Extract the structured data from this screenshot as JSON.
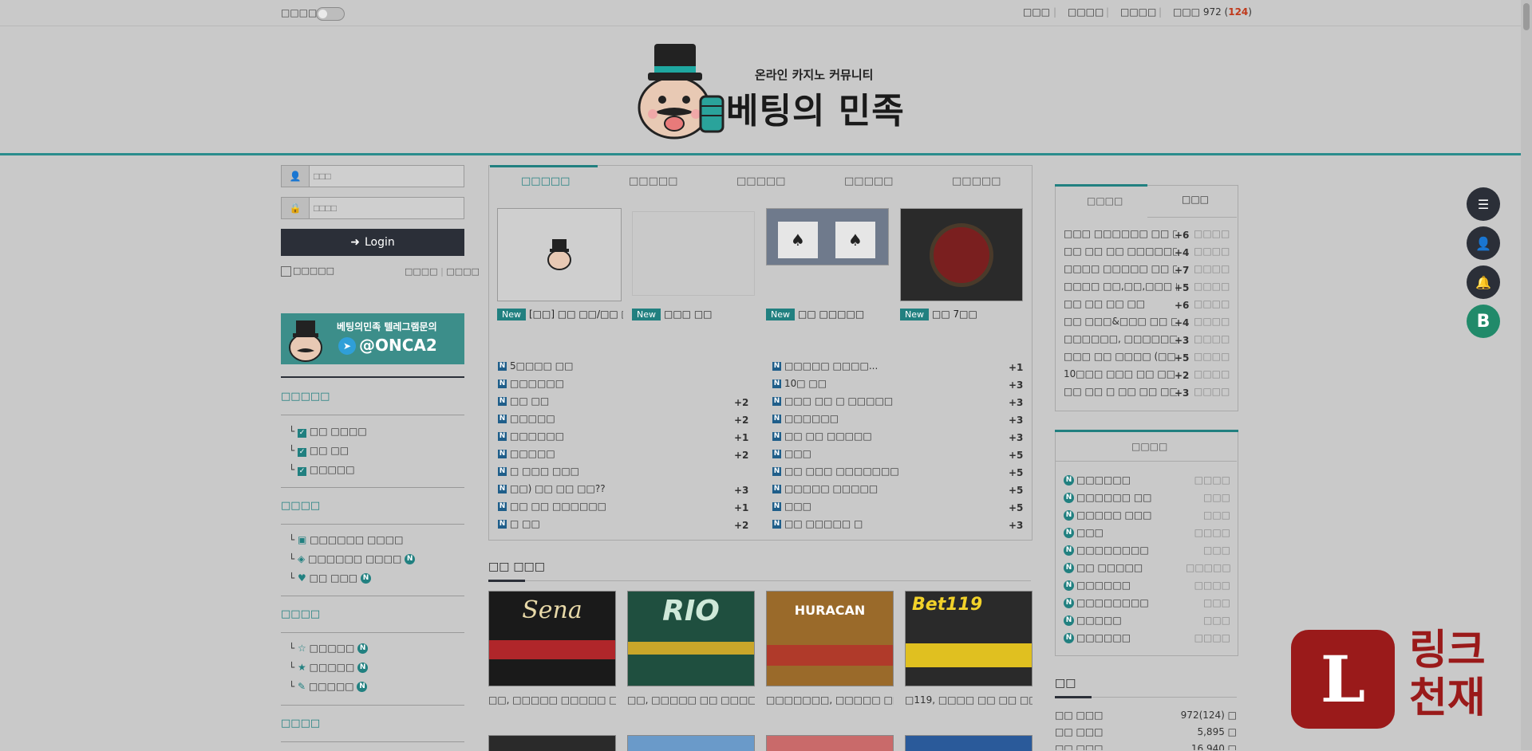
{
  "topbar": {
    "toggle_label": "□□□□",
    "links": [
      "□□□",
      "□□□□",
      "□□□□"
    ],
    "visitor_label": "□□□ 972",
    "visitor_paren": "124"
  },
  "logo": {
    "tagline": "온라인 카지노 커뮤니티",
    "name": "베팅의 민족"
  },
  "login": {
    "id_placeholder": "□□□",
    "pw_placeholder": "□□□□",
    "button": "Login",
    "remember": "□□□□□",
    "link1": "□□□□",
    "link2": "□□□□"
  },
  "telegram": {
    "line1": "베팅의민족 텔레그램문의",
    "handle": "@ONCA2"
  },
  "left_sections": [
    {
      "title": "□□□□□",
      "items": [
        "□□ □□□□",
        "□□ □□",
        "□□□□□"
      ]
    },
    {
      "title": "□□□□",
      "items": [
        "□□□□□□ □□□□",
        "□□□□□□ □□□□",
        "□□ □□□"
      ]
    },
    {
      "title": "□□□□",
      "items": [
        "□□□□□",
        "□□□□□",
        "□□□□□"
      ]
    },
    {
      "title": "□□□□"
    }
  ],
  "main_tabs": [
    "□□□□□",
    "□□□□□",
    "□□□□□",
    "□□□□□",
    "□□□□□"
  ],
  "gallery": [
    {
      "badge": "New",
      "caption": "[□□] □□ □□/□□ □□+□"
    },
    {
      "badge": "New",
      "caption": "□□□ □□"
    },
    {
      "badge": "New",
      "caption": "□□ □□□□□"
    },
    {
      "badge": "New",
      "caption": "□□ 7□□"
    }
  ],
  "list_left": [
    {
      "t": "5□□□□ □□",
      "c": ""
    },
    {
      "t": "□□□□□□",
      "c": ""
    },
    {
      "t": "□□ □□",
      "c": "+2"
    },
    {
      "t": "□□□□□",
      "c": "+2"
    },
    {
      "t": "□□□□□□",
      "c": "+1"
    },
    {
      "t": "□□□□□",
      "c": "+2"
    },
    {
      "t": "□ □□□ □□□",
      "c": ""
    },
    {
      "t": "□□) □□ □□ □□??",
      "c": "+3"
    },
    {
      "t": "□□ □□ □□□□□□",
      "c": "+1"
    },
    {
      "t": "□ □□",
      "c": "+2"
    }
  ],
  "list_right": [
    {
      "t": "□□□□□ □□□□...",
      "c": "+1"
    },
    {
      "t": "10□ □□",
      "c": "+3"
    },
    {
      "t": "□□□ □□ □ □□□□□",
      "c": "+3"
    },
    {
      "t": "□□□□□□",
      "c": "+3"
    },
    {
      "t": "□□ □□ □□□□□",
      "c": "+3"
    },
    {
      "t": "□□□",
      "c": "+5"
    },
    {
      "t": "□□ □□□ □□□□□□□",
      "c": "+5"
    },
    {
      "t": "□□□□□ □□□□□",
      "c": "+5"
    },
    {
      "t": "□□□",
      "c": "+5"
    },
    {
      "t": "□□ □□□□□ □",
      "c": "+3"
    }
  ],
  "partners": {
    "title": "□□ □□□",
    "captions": [
      "□□, □□□□□ □□□□□ □□□□ □□□□□",
      "□□, □□□□□ □□ □□□□□ □□□□□ □",
      "□□□□□□□, □□□□□ □□□□ □□ □□□",
      "□119, □□□□ □□ □□ □□□ □□□ □"
    ]
  },
  "right_tabs": [
    "□□□□",
    "□□□"
  ],
  "popular": [
    {
      "t": "□□□ □□□□□□ □□ □□",
      "c": "+66",
      "d": "□□□□□□"
    },
    {
      "t": "□□ □□ □□ □□□□□□ □...",
      "c": "+42",
      "d": "□□□□□□"
    },
    {
      "t": "□□□□ □□□□□ □□ □□ □□",
      "c": "+78",
      "d": "□□□□□□"
    },
    {
      "t": "□□□□ □□,□□,□□□ □...",
      "c": "+51",
      "d": "□□□□□□"
    },
    {
      "t": "□□ □□ □□ □□",
      "c": "+66",
      "d": "□□□□□□"
    },
    {
      "t": "□□ □□□&□□□ □□ □□...",
      "c": "+42",
      "d": "□□□□□□"
    },
    {
      "t": "□□□□□□, □□□□□□□ ...",
      "c": "+38",
      "d": "□□□□□□"
    },
    {
      "t": "□□□ □□ □□□□ (□□□ 5□)",
      "c": "+5",
      "d": "□□□□□□"
    },
    {
      "t": "10□□□ □□□ □□ □□",
      "c": "+25",
      "d": "□□□□□□"
    },
    {
      "t": "□□ □□ □ □□ □□ □□ □...",
      "c": "+33",
      "d": "□□□□□□"
    }
  ],
  "latest_title": "□□□□",
  "latest": [
    {
      "t": "□□□□□□",
      "d": "□□□□"
    },
    {
      "t": "□□□□□□ □□",
      "d": "□□□"
    },
    {
      "t": "□□□□□ □□□",
      "d": "□□□"
    },
    {
      "t": "□□□",
      "d": "□□□□"
    },
    {
      "t": "□□□□□□□□",
      "d": "□□□"
    },
    {
      "t": "□□ □□□□□",
      "d": "□□□□□"
    },
    {
      "t": "□□□□□□",
      "d": "□□□□"
    },
    {
      "t": "□□□□□□□□",
      "d": "□□□"
    },
    {
      "t": "□□□□□",
      "d": "□□□"
    },
    {
      "t": "□□□□□□",
      "d": "□□□□"
    }
  ],
  "stats": {
    "title": "□□",
    "rows": [
      {
        "k": "□□ □□□",
        "v": "972(124) □"
      },
      {
        "k": "□□ □□□",
        "v": "5,895 □"
      },
      {
        "k": "□□ □□□",
        "v": "16,940 □"
      }
    ]
  },
  "floating": {
    "b_label": "B"
  },
  "watermark": {
    "letter": "L",
    "line1": "링크",
    "line2": "천재"
  }
}
